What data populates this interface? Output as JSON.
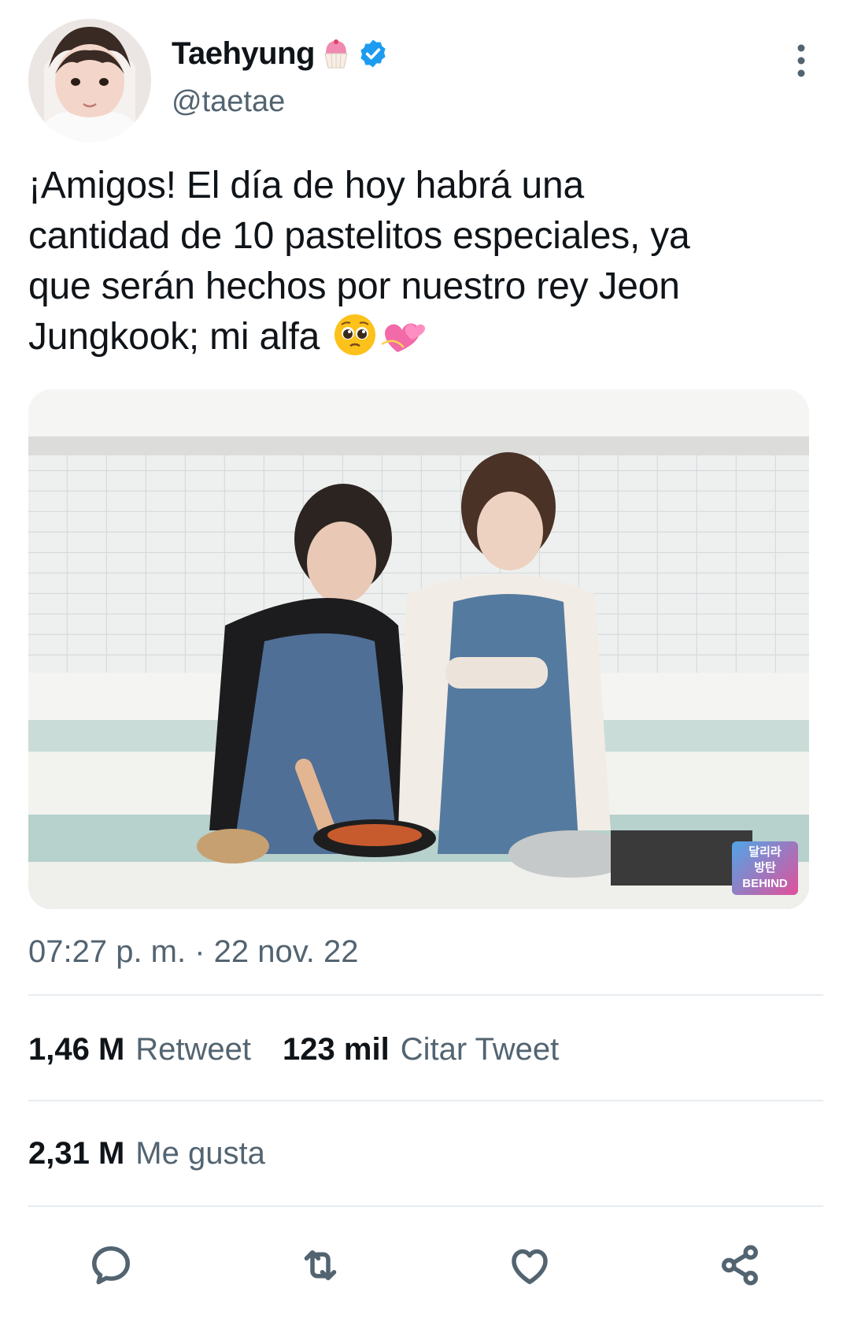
{
  "author": {
    "name": "Taehyung",
    "handle": "@taetae",
    "name_emoji": "cupcake-icon",
    "verified": true
  },
  "tweet": {
    "text_line1": "¡Amigos! El día de hoy habrá una",
    "text_line2": "cantidad de 10 pastelitos especiales, ya",
    "text_line3": "que serán hechos por nuestro rey Jeon",
    "text_line4": "Jungkook; mi alfa",
    "trailing_emojis": [
      "pleading-face-icon",
      "two-hearts-icon"
    ]
  },
  "media": {
    "watermark_line1": "달리라",
    "watermark_line2": "방탄",
    "watermark_line3": "BEHIND"
  },
  "meta": {
    "timestamp": "07:27 p. m. · 22 nov. 22"
  },
  "stats": {
    "retweets_count": "1,46 M",
    "retweets_label": "Retweet",
    "quotes_count": "123 mil",
    "quotes_label": "Citar Tweet",
    "likes_count": "2,31 M",
    "likes_label": "Me gusta"
  },
  "actions": [
    "reply-icon",
    "retweet-icon",
    "like-icon",
    "share-icon"
  ],
  "colors": {
    "text": "#0f1419",
    "secondary": "#536471",
    "verified": "#1d9bf0",
    "divider": "#e6ecf0"
  }
}
